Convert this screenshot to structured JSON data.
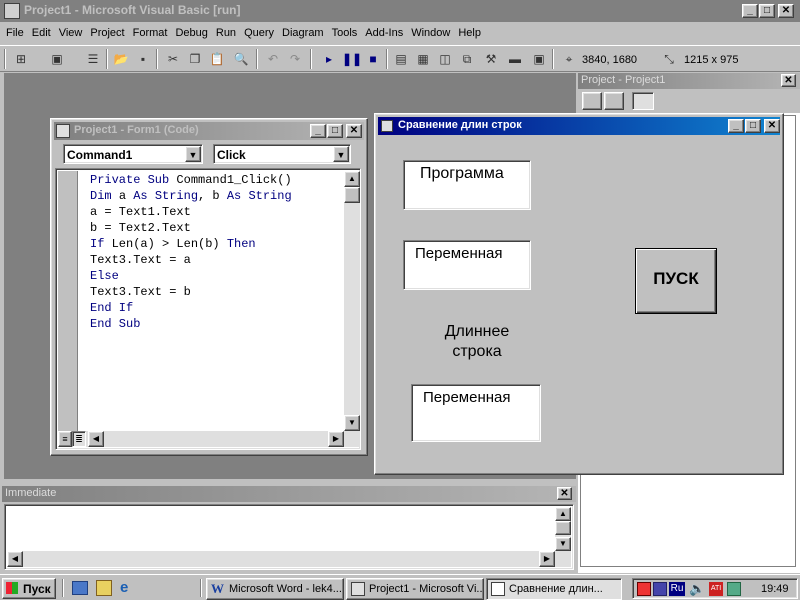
{
  "app": {
    "title": "Project1 - Microsoft Visual Basic [run]",
    "menu": [
      "File",
      "Edit",
      "View",
      "Project",
      "Format",
      "Debug",
      "Run",
      "Query",
      "Diagram",
      "Tools",
      "Add-Ins",
      "Window",
      "Help"
    ],
    "position_readout": "3840, 1680",
    "size_readout": "1215 x 975"
  },
  "code_window": {
    "title": "Project1 - Form1 (Code)",
    "object_combo": "Command1",
    "proc_combo": "Click",
    "lines": [
      "Private Sub Command1_Click()",
      "Dim a As String, b As String",
      "a = Text1.Text",
      "b = Text2.Text",
      "If Len(a) > Len(b) Then",
      "Text3.Text = a",
      "Else",
      "Text3.Text = b",
      "End If",
      "End Sub"
    ]
  },
  "form": {
    "title": "Сравнение длин строк",
    "text1": "Программа",
    "text2": "Переменная",
    "label": "Длиннее\nстрока",
    "text3": "Переменная",
    "button": "ПУСК"
  },
  "project_panel": {
    "title": "Project - Project1"
  },
  "immediate": {
    "title": "Immediate"
  },
  "taskbar": {
    "start": "Пуск",
    "tasks": [
      "Microsoft Word - lek4...",
      "Project1 - Microsoft Vi...",
      "Сравнение длин..."
    ],
    "lang": "Ru",
    "clock": "19:49"
  },
  "colors": {
    "title_active": "#000080",
    "workspace": "#808080",
    "keyword": "#000080"
  }
}
